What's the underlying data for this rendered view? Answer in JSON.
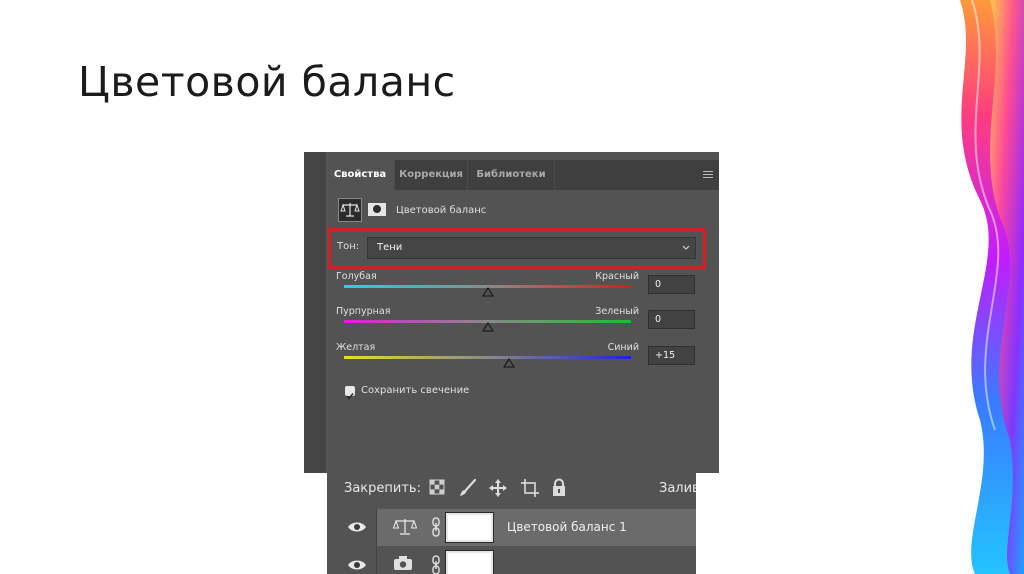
{
  "slide": {
    "title": "Цветовой баланс"
  },
  "properties_panel": {
    "tabs": [
      {
        "label": "Свойства",
        "active": true
      },
      {
        "label": "Коррекция",
        "active": false
      },
      {
        "label": "Библиотеки",
        "active": false
      }
    ],
    "adjustment_title": "Цветовой баланс",
    "tone": {
      "label": "Тон:",
      "value": "Тени"
    },
    "sliders": [
      {
        "left": "Голубая",
        "right": "Красный",
        "value": "0",
        "position": 0.5,
        "gradient": [
          "#19d8e6",
          "#e01a1a"
        ]
      },
      {
        "left": "Пурпурная",
        "right": "Зеленый",
        "value": "0",
        "position": 0.5,
        "gradient": [
          "#e21ce0",
          "#19c12b"
        ]
      },
      {
        "left": "Желтая",
        "right": "Синий",
        "value": "+15",
        "position": 0.575,
        "gradient": [
          "#e8e01c",
          "#1a22e6"
        ]
      }
    ],
    "preserve_luminosity": {
      "label": "Сохранить свечение",
      "checked": true
    },
    "highlight_color": "#d42020"
  },
  "layers_panel": {
    "lock_label": "Закрепить:",
    "fill_label": "Залив",
    "layers": [
      {
        "name": "Цветовой баланс 1",
        "selected": true
      },
      {
        "name": "",
        "selected": false
      }
    ]
  }
}
